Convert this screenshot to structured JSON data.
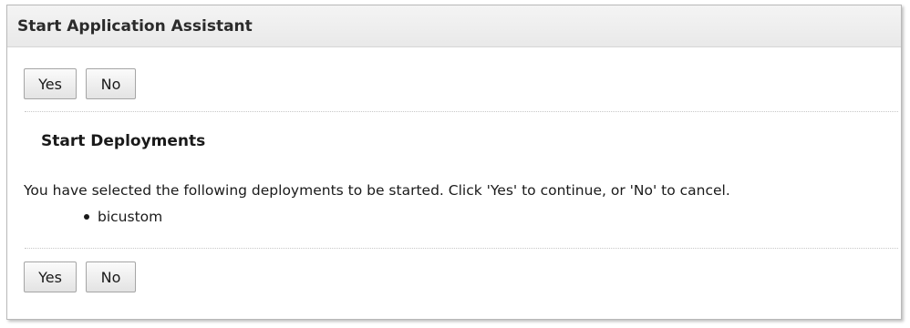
{
  "window": {
    "title": "Start Application Assistant"
  },
  "actions_top": {
    "yes_label": "Yes",
    "no_label": "No"
  },
  "section": {
    "title": "Start Deployments",
    "message": "You have selected the following deployments to be started. Click 'Yes' to continue, or 'No' to cancel."
  },
  "deployments": [
    {
      "name": "bicustom"
    }
  ],
  "actions_bottom": {
    "yes_label": "Yes",
    "no_label": "No"
  }
}
